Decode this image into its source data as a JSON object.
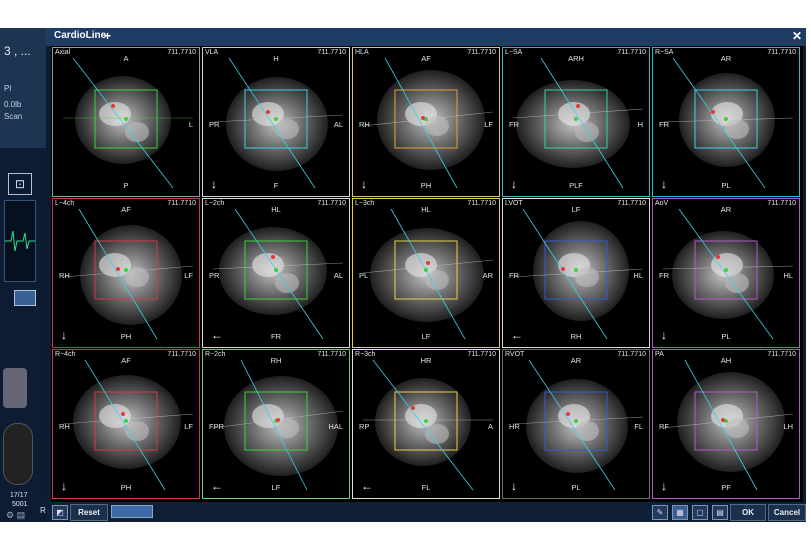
{
  "left_panel": {
    "title": "3 , ...",
    "sub1": "Pl",
    "sub2": "0.0lb",
    "sub3": "Scan",
    "count": "17/17",
    "count2": "5001",
    "icon_label": "R"
  },
  "window": {
    "title": "CardioLine",
    "plus": "+",
    "close": "✕"
  },
  "cells": [
    {
      "tag": "Axial",
      "num": "711.7710",
      "top": "A",
      "bottom": "P",
      "left": "",
      "right": "L",
      "arrow": ""
    },
    {
      "tag": "VLA",
      "num": "711.7710",
      "top": "H",
      "bottom": "F",
      "left": "PR",
      "right": "AL",
      "arrow": "↓"
    },
    {
      "tag": "HLA",
      "num": "711.7710",
      "top": "AF",
      "bottom": "PH",
      "left": "RH",
      "right": "LF",
      "arrow": "↓"
    },
    {
      "tag": "L−SA",
      "num": "711.7710",
      "top": "ARH",
      "bottom": "PLF",
      "left": "FR",
      "right": "H",
      "arrow": "↓"
    },
    {
      "tag": "R−SA",
      "num": "711.7710",
      "top": "AR",
      "bottom": "PL",
      "left": "FR",
      "right": "",
      "arrow": "↓"
    },
    {
      "tag": "L−4ch",
      "num": "711.7710",
      "top": "AF",
      "bottom": "PH",
      "left": "RH",
      "right": "LF",
      "arrow": "↓"
    },
    {
      "tag": "L−2ch",
      "num": "711.7710",
      "top": "HL",
      "bottom": "FR",
      "left": "PR",
      "right": "AL",
      "arrow": "←"
    },
    {
      "tag": "L−3ch",
      "num": "711.7710",
      "top": "HL",
      "bottom": "LF",
      "left": "PL",
      "right": "AR",
      "arrow": ""
    },
    {
      "tag": "LVOT",
      "num": "711.7710",
      "top": "LF",
      "bottom": "RH",
      "left": "FR",
      "right": "HL",
      "arrow": "←"
    },
    {
      "tag": "AoV",
      "num": "711.7710",
      "top": "AR",
      "bottom": "PL",
      "left": "FR",
      "right": "HL",
      "arrow": "↓"
    },
    {
      "tag": "R−4ch",
      "num": "711.7710",
      "top": "AF",
      "bottom": "PH",
      "left": "RH",
      "right": "LF",
      "arrow": "↓"
    },
    {
      "tag": "R−2ch",
      "num": "711.7710",
      "top": "RH",
      "bottom": "LF",
      "left": "FPR",
      "right": "HAL",
      "arrow": "←"
    },
    {
      "tag": "R−3ch",
      "num": "711.7710",
      "top": "HR",
      "bottom": "FL",
      "left": "RP",
      "right": "A",
      "arrow": "←"
    },
    {
      "tag": "RVOT",
      "num": "711.7710",
      "top": "AR",
      "bottom": "PL",
      "left": "HR",
      "right": "FL",
      "arrow": "↓"
    },
    {
      "tag": "PA",
      "num": "711.7710",
      "top": "AH",
      "bottom": "PF",
      "left": "RF",
      "right": "LH",
      "arrow": "↓"
    }
  ],
  "buttons": {
    "reset": "Reset",
    "ok": "OK",
    "cancel": "Cancel"
  }
}
